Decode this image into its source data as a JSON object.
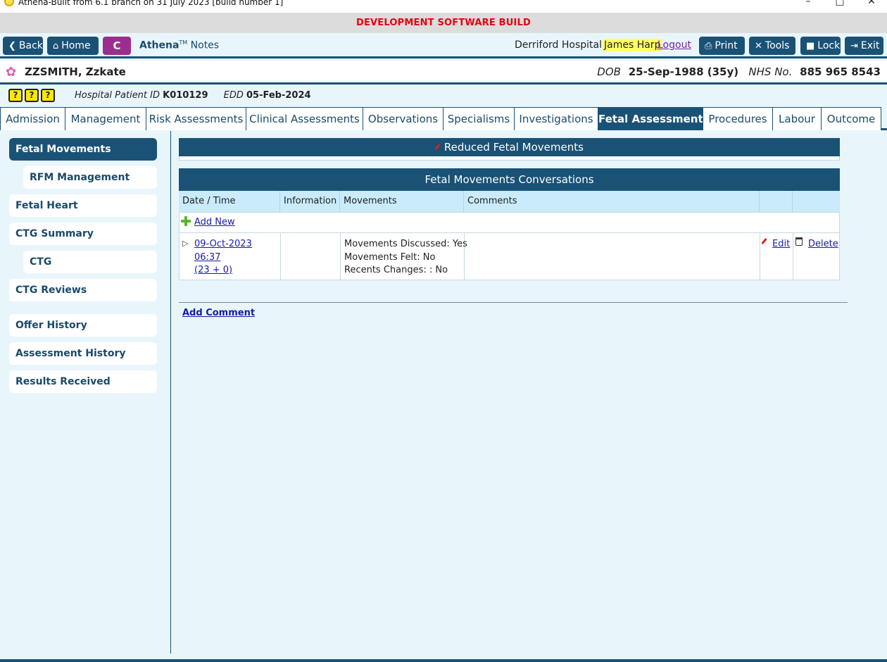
{
  "window": {
    "title": "Athena-Built from 6.1 branch on 31 July 2023 [build number 1]",
    "controls": [
      "–",
      "□",
      "✕"
    ]
  },
  "banner": "DEVELOPMENT SOFTWARE BUILD",
  "toolbar": {
    "back": "Back",
    "home": "Home",
    "c": "C",
    "brand": "Athena",
    "brand_tm": "TM",
    "brand_notes": "Notes",
    "hospital": "Derriford Hospital",
    "user": "James Harp",
    "logout": "Logout",
    "print": "Print",
    "tools": "Tools",
    "lock": "Lock",
    "exit": "Exit"
  },
  "patient": {
    "name": "ZZSMITH, Zzkate",
    "dob_label": "DOB",
    "dob": "25-Sep-1988 (35y)",
    "nhs_label": "NHS No.",
    "nhs": "885 965 8543"
  },
  "info": {
    "hospital_id_label": "Hospital Patient ID",
    "hospital_id": "K010129",
    "edd_label": "EDD",
    "edd": "05-Feb-2024"
  },
  "tabs": [
    "Admission",
    "Management",
    "Risk Assessments",
    "Clinical Assessments",
    "Observations",
    "Specialisms",
    "Investigations",
    "Fetal Assessments",
    "Procedures",
    "Labour",
    "Outcome"
  ],
  "sidebar": [
    "Fetal Movements",
    "RFM Management",
    "Fetal Heart",
    "CTG Summary",
    "CTG",
    "CTG Reviews",
    "Offer History",
    "Assessment History",
    "Results Received"
  ],
  "content": {
    "rfm_title": "Reduced Fetal Movements",
    "conv_title": "Fetal Movements Conversations",
    "columns": [
      "Date / Time",
      "Information",
      "Movements",
      "Comments",
      "",
      ""
    ],
    "add_new": "Add New",
    "row": {
      "datetime": "09-Oct-2023 06:37",
      "gestation": "(23 + 0)",
      "mv1": "Movements Discussed: Yes",
      "mv2": "Movements Felt: No",
      "mv3": "Recents Changes: : No",
      "edit": "Edit",
      "delete": "Delete"
    },
    "add_comment": "Add Comment"
  }
}
